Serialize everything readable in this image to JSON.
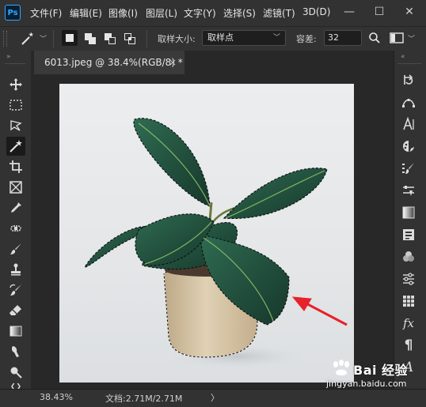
{
  "app": {
    "logo_text": "Ps"
  },
  "menu": {
    "items": [
      {
        "label": "文件(F)"
      },
      {
        "label": "编辑(E)"
      },
      {
        "label": "图像(I)"
      },
      {
        "label": "图层(L)"
      },
      {
        "label": "文字(Y)"
      },
      {
        "label": "选择(S)"
      },
      {
        "label": "滤镜(T)"
      },
      {
        "label": "3D(D)"
      }
    ]
  },
  "options_bar": {
    "sample_size_label": "取样大小:",
    "sample_size_value": "取样点",
    "tolerance_label": "容差:",
    "tolerance_value": "32"
  },
  "document_tab": {
    "title": "6013.jpeg @ 38.4%(RGB/8) *",
    "close": "×"
  },
  "status_bar": {
    "zoom": "38.43%",
    "doc_info": "文档:2.71M/2.71M",
    "arrow": "〉"
  },
  "watermark": {
    "brand": "Bai 经验",
    "url": "jingyan.baidu.com"
  },
  "colors": {
    "accent": "#31a8ff",
    "annotation_arrow": "#e8212b",
    "leaf_dark": "#1f4a3a",
    "pot": "#d8c6a8"
  },
  "icons": {
    "left_tools": [
      "move-icon",
      "marquee-icon",
      "lasso-icon",
      "magic-wand-icon",
      "crop-icon",
      "frame-icon",
      "eyedropper-icon",
      "spot-healing-icon",
      "brush-icon",
      "clone-stamp-icon",
      "history-brush-icon",
      "eraser-icon",
      "gradient-icon",
      "smudge-icon",
      "dodge-icon",
      "pen-icon"
    ],
    "right_panels": [
      "history-icon",
      "paths-icon",
      "character-icon",
      "color-icon",
      "brushes-icon",
      "adjustments-icon",
      "gradients-icon",
      "properties-icon",
      "channels-icon",
      "adjustment-sliders-icon",
      "swatches-icon",
      "styles-icon",
      "paragraph-icon",
      "glyphs-icon"
    ]
  }
}
